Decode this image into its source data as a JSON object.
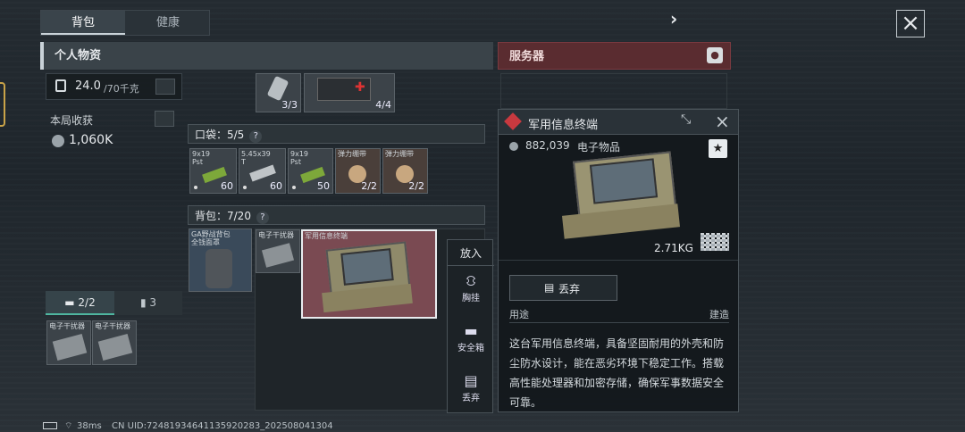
{
  "tabs": [
    {
      "label": "背包"
    },
    {
      "label": "健康"
    }
  ],
  "top": {
    "arrow": "›",
    "close": "×"
  },
  "personal": {
    "title": "个人物资",
    "weight_value": "24.0",
    "weight_max": "/70千克",
    "earnings_label": "本局收获",
    "earnings_value": "1,060K",
    "case_tab1": "2/2",
    "case_tab2": "3",
    "case_items": [
      {
        "label": "电子干扰器"
      },
      {
        "label": "电子干扰器"
      }
    ]
  },
  "top_items": [
    {
      "label": "",
      "count": "3/3"
    },
    {
      "label": "",
      "count": "4/4"
    }
  ],
  "pocket": {
    "title": "口袋：5/5",
    "items": [
      {
        "label": "9x19\nPst",
        "count": "60"
      },
      {
        "label": "5.45x39\nT",
        "count": "60"
      },
      {
        "label": "9x19\nPst",
        "count": "50"
      },
      {
        "label": "弹力绷带",
        "count": "2/2"
      },
      {
        "label": "弹力绷带",
        "count": "2/2"
      }
    ]
  },
  "backpack": {
    "title": "背包：7/20",
    "items": [
      {
        "label": "GA野战背包\n全钱面罩"
      },
      {
        "label": "电子干扰器"
      },
      {
        "label": "军用信息终端"
      }
    ]
  },
  "context_menu": {
    "header": "放入",
    "items": [
      {
        "label": "胸挂"
      },
      {
        "label": "安全箱"
      },
      {
        "label": "丢弃"
      }
    ]
  },
  "server": {
    "title": "服务器"
  },
  "detail": {
    "title": "军用信息终端",
    "price": "882,039",
    "category": "电子物品",
    "weight": "2.71KG",
    "discard_label": "丢弃",
    "usage_label": "用途",
    "usage_value": "建造",
    "description": "这台军用信息终端，具备坚固耐用的外壳和防尘防水设计，能在恶劣环境下稳定工作。搭载高性能处理器和加密存储，确保军事数据安全可靠。"
  },
  "status": {
    "ping": "38ms",
    "uid": "CN UID:7248193464113592​0283_202508041304"
  },
  "colors": {
    "accent_red": "#c8393f",
    "server_header": "#5a2c30",
    "selected_item_bg": "#7a4a52"
  }
}
